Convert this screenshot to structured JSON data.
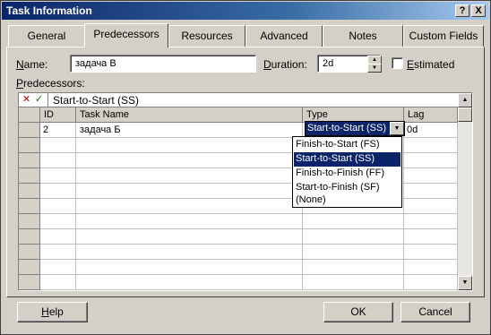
{
  "window": {
    "title": "Task Information",
    "help_glyph": "?",
    "close_glyph": "X"
  },
  "tabs": [
    {
      "label": "General"
    },
    {
      "label": "Predecessors"
    },
    {
      "label": "Resources"
    },
    {
      "label": "Advanced"
    },
    {
      "label": "Notes"
    },
    {
      "label": "Custom Fields"
    }
  ],
  "form": {
    "name_label_u": "N",
    "name_label_rest": "ame:",
    "name_value": "задача В",
    "duration_label_u": "D",
    "duration_label_rest": "uration:",
    "duration_value": "2d",
    "estimated_label_u": "E",
    "estimated_label_rest": "stimated",
    "estimated_checked": false,
    "predecessors_label_u": "P",
    "predecessors_label_rest": "redecessors:"
  },
  "grid": {
    "edit_value": "Start-to-Start (SS)",
    "cancel_glyph": "✕",
    "accept_glyph": "✓",
    "columns": [
      "ID",
      "Task Name",
      "Type",
      "Lag"
    ],
    "rows": [
      {
        "id": "2",
        "task_name": "задача Б",
        "type": "Start-to-Start (SS)",
        "lag": "0d"
      }
    ]
  },
  "type_dropdown": {
    "selected": "Start-to-Start (SS)",
    "options": [
      "Finish-to-Start (FS)",
      "Start-to-Start (SS)",
      "Finish-to-Finish (FF)",
      "Start-to-Finish (SF)",
      "(None)"
    ]
  },
  "buttons": {
    "help_u": "H",
    "help_rest": "elp",
    "ok": "OK",
    "cancel": "Cancel"
  },
  "colors": {
    "dialog_bg": "#d4d0c8",
    "title_bar": "#0a246a",
    "selection": "#0a246a",
    "cancel_edit": "#cc0000",
    "accept_edit": "#008000"
  }
}
